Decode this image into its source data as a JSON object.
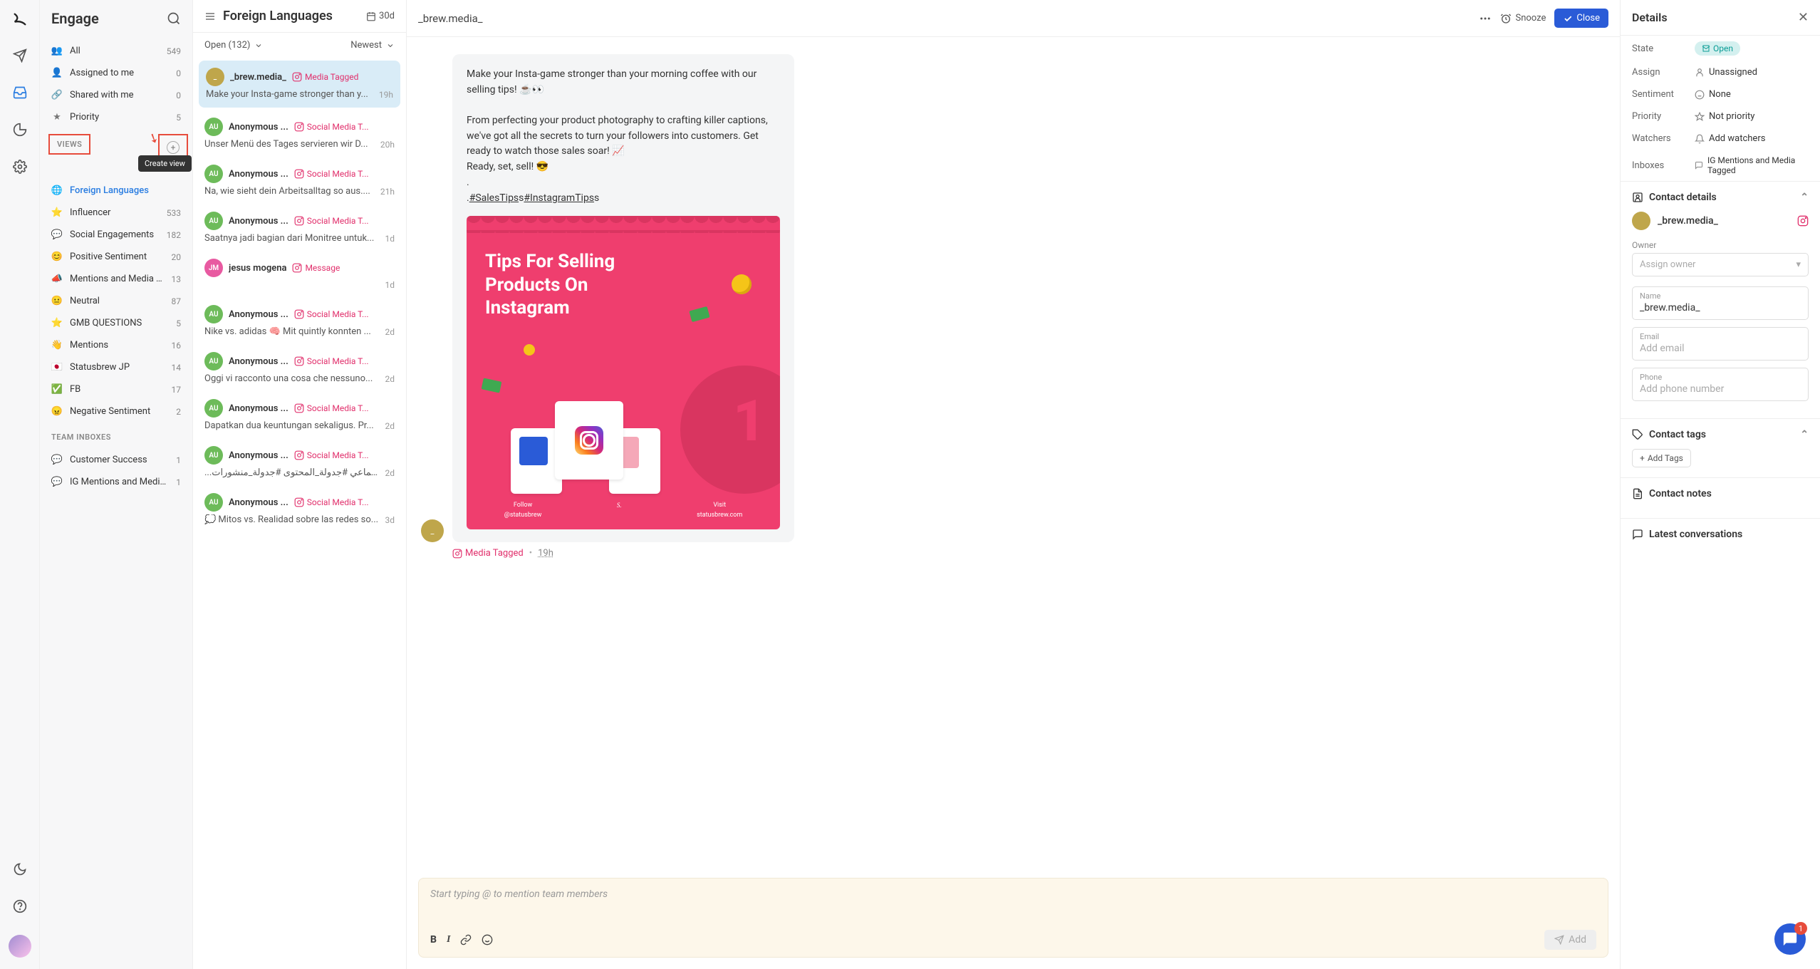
{
  "app_title": "Engage",
  "sidebar": {
    "filters": [
      {
        "icon": "👥",
        "label": "All",
        "count": "549"
      },
      {
        "icon": "👤",
        "label": "Assigned to me",
        "count": "0"
      },
      {
        "icon": "🔗",
        "label": "Shared with me",
        "count": "0"
      },
      {
        "icon": "★",
        "label": "Priority",
        "count": "5"
      }
    ],
    "views_label": "VIEWS",
    "create_view_tooltip": "Create view",
    "views": [
      {
        "icon": "🌐",
        "label": "Foreign Languages",
        "count": "",
        "active": true
      },
      {
        "icon": "⭐",
        "label": "Influencer",
        "count": "533"
      },
      {
        "icon": "💬",
        "label": "Social Engagements",
        "count": "182"
      },
      {
        "icon": "😊",
        "label": "Positive Sentiment",
        "count": "20"
      },
      {
        "icon": "📣",
        "label": "Mentions and Media Tagg...",
        "count": "13"
      },
      {
        "icon": "😐",
        "label": "Neutral",
        "count": "87"
      },
      {
        "icon": "⭐",
        "label": "GMB QUESTIONS",
        "count": "5"
      },
      {
        "icon": "👋",
        "label": "Mentions",
        "count": "16"
      },
      {
        "icon": "🇯🇵",
        "label": "Statusbrew JP",
        "count": "14"
      },
      {
        "icon": "✅",
        "label": "FB",
        "count": "17"
      },
      {
        "icon": "😠",
        "label": "Negative Sentiment",
        "count": "2"
      }
    ],
    "team_inboxes_label": "TEAM INBOXES",
    "team_inboxes": [
      {
        "icon": "💬",
        "label": "Customer Success",
        "count": "1"
      },
      {
        "icon": "💬",
        "label": "IG Mentions and Media Tag...",
        "count": "1"
      }
    ]
  },
  "conv_col": {
    "title": "Foreign Languages",
    "duration": "30d",
    "status": "Open (132)",
    "sort": "Newest",
    "items": [
      {
        "avatar_class": "brew",
        "initials": "_",
        "name": "_brew.media_",
        "tag": "Media Tagged",
        "preview": "Make your Insta-game stronger than y...",
        "time": "19h",
        "selected": true
      },
      {
        "avatar_class": "anon",
        "initials": "AU",
        "name": "Anonymous ...",
        "tag": "Social Media T...",
        "preview": "Unser Menü des Tages servieren wir D...",
        "time": "20h"
      },
      {
        "avatar_class": "anon",
        "initials": "AU",
        "name": "Anonymous ...",
        "tag": "Social Media T...",
        "preview": "Na, wie sieht dein Arbeitsalltag so aus....",
        "time": "21h"
      },
      {
        "avatar_class": "anon",
        "initials": "AU",
        "name": "Anonymous ...",
        "tag": "Social Media T...",
        "preview": "Saatnya jadi bagian dari Monitree untuk...",
        "time": "1d"
      },
      {
        "avatar_class": "jm",
        "initials": "JM",
        "name": "jesus mogena",
        "tag": "Message",
        "preview": "",
        "time": "1d"
      },
      {
        "avatar_class": "anon",
        "initials": "AU",
        "name": "Anonymous ...",
        "tag": "Social Media T...",
        "preview": "Nike vs. adidas 🧠 Mit quintly konnten ...",
        "time": "2d"
      },
      {
        "avatar_class": "anon",
        "initials": "AU",
        "name": "Anonymous ...",
        "tag": "Social Media T...",
        "preview": "Oggi vi racconto una cosa che nessuno...",
        "time": "2d"
      },
      {
        "avatar_class": "anon",
        "initials": "AU",
        "name": "Anonymous ...",
        "tag": "Social Media T...",
        "preview": "Dapatkan dua keuntungan sekaligus. Pr...",
        "time": "2d"
      },
      {
        "avatar_class": "anon",
        "initials": "AU",
        "name": "Anonymous ...",
        "tag": "Social Media T...",
        "preview": "...واصل_الاجتماعي #جدولة_المحتوى #جدولة_منشورات",
        "time": "2d"
      },
      {
        "avatar_class": "anon",
        "initials": "AU",
        "name": "Anonymous ...",
        "tag": "Social Media T...",
        "preview": "💭 Mitos vs. Realidad sobre las redes so...",
        "time": "3d"
      }
    ]
  },
  "main": {
    "contact": "_brew.media_",
    "snooze": "Snooze",
    "close": "Close",
    "message_p1": "Make your Insta-game stronger than your morning coffee with our selling tips! ☕👀",
    "message_p2": "From perfecting your product photography to crafting killer captions, we've got all the secrets to turn your followers into customers. Get ready to watch those sales soar! 📈",
    "message_p3": "Ready, set, sell! 😎",
    "message_p4": ".",
    "hashtag1": "#SalesTips",
    "hashtag_s1": "s",
    "hashtag2": "#InstagramTips",
    "hashtag_s2": "s",
    "image_title": "Tips For Selling Products On Instagram",
    "image_follow": "Follow",
    "image_handle": "@statusbrew",
    "image_visit": "Visit",
    "image_site": "statusbrew.com",
    "meta_tag": "Media Tagged",
    "meta_time": "19h",
    "composer_placeholder": "Start typing @ to mention team members",
    "composer_add": "Add"
  },
  "details": {
    "title": "Details",
    "rows": {
      "state": {
        "label": "State",
        "value": "Open"
      },
      "assign": {
        "label": "Assign",
        "value": "Unassigned"
      },
      "sentiment": {
        "label": "Sentiment",
        "value": "None"
      },
      "priority": {
        "label": "Priority",
        "value": "Not priority"
      },
      "watchers": {
        "label": "Watchers",
        "value": "Add watchers"
      },
      "inboxes": {
        "label": "Inboxes",
        "value": "IG Mentions and Media Tagged"
      }
    },
    "contact_section": "Contact details",
    "contact_name": "_brew.media_",
    "owner_label": "Owner",
    "owner_placeholder": "Assign owner",
    "name_label": "Name",
    "name_value": "_brew.media_",
    "email_label": "Email",
    "email_placeholder": "Add email",
    "phone_label": "Phone",
    "phone_placeholder": "Add phone number",
    "tags_section": "Contact tags",
    "add_tags": "Add Tags",
    "notes_section": "Contact notes",
    "latest_section": "Latest conversations"
  },
  "chat_badge": "1"
}
